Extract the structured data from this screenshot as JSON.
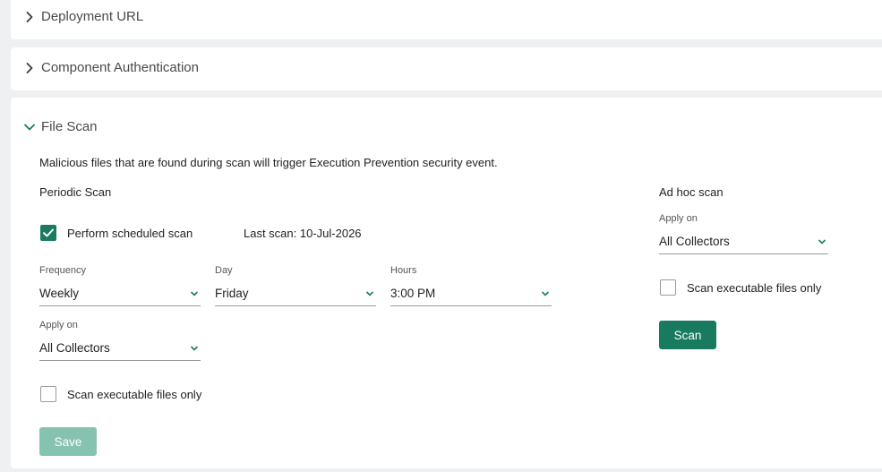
{
  "accordions": {
    "deployment_url": "Deployment URL",
    "component_auth": "Component Authentication",
    "file_scan": "File Scan"
  },
  "file_scan": {
    "description": "Malicious files that are found during scan will trigger Execution Prevention security event.",
    "periodic": {
      "title": "Periodic Scan",
      "perform_label": "Perform scheduled scan",
      "perform_checked": true,
      "last_scan": "Last scan: 10-Jul-2026",
      "frequency_label": "Frequency",
      "frequency_value": "Weekly",
      "day_label": "Day",
      "day_value": "Friday",
      "hours_label": "Hours",
      "hours_value": "3:00 PM",
      "apply_label": "Apply on",
      "apply_value": "All Collectors",
      "exec_only_label": "Scan executable files only",
      "exec_only_checked": false,
      "save_label": "Save"
    },
    "adhoc": {
      "title": "Ad hoc scan",
      "apply_label": "Apply on",
      "apply_value": "All Collectors",
      "exec_only_label": "Scan executable files only",
      "exec_only_checked": false,
      "scan_label": "Scan"
    }
  },
  "colors": {
    "accent": "#1b7a60",
    "disabled_button": "#86c2b0",
    "background": "#eef0f1"
  }
}
